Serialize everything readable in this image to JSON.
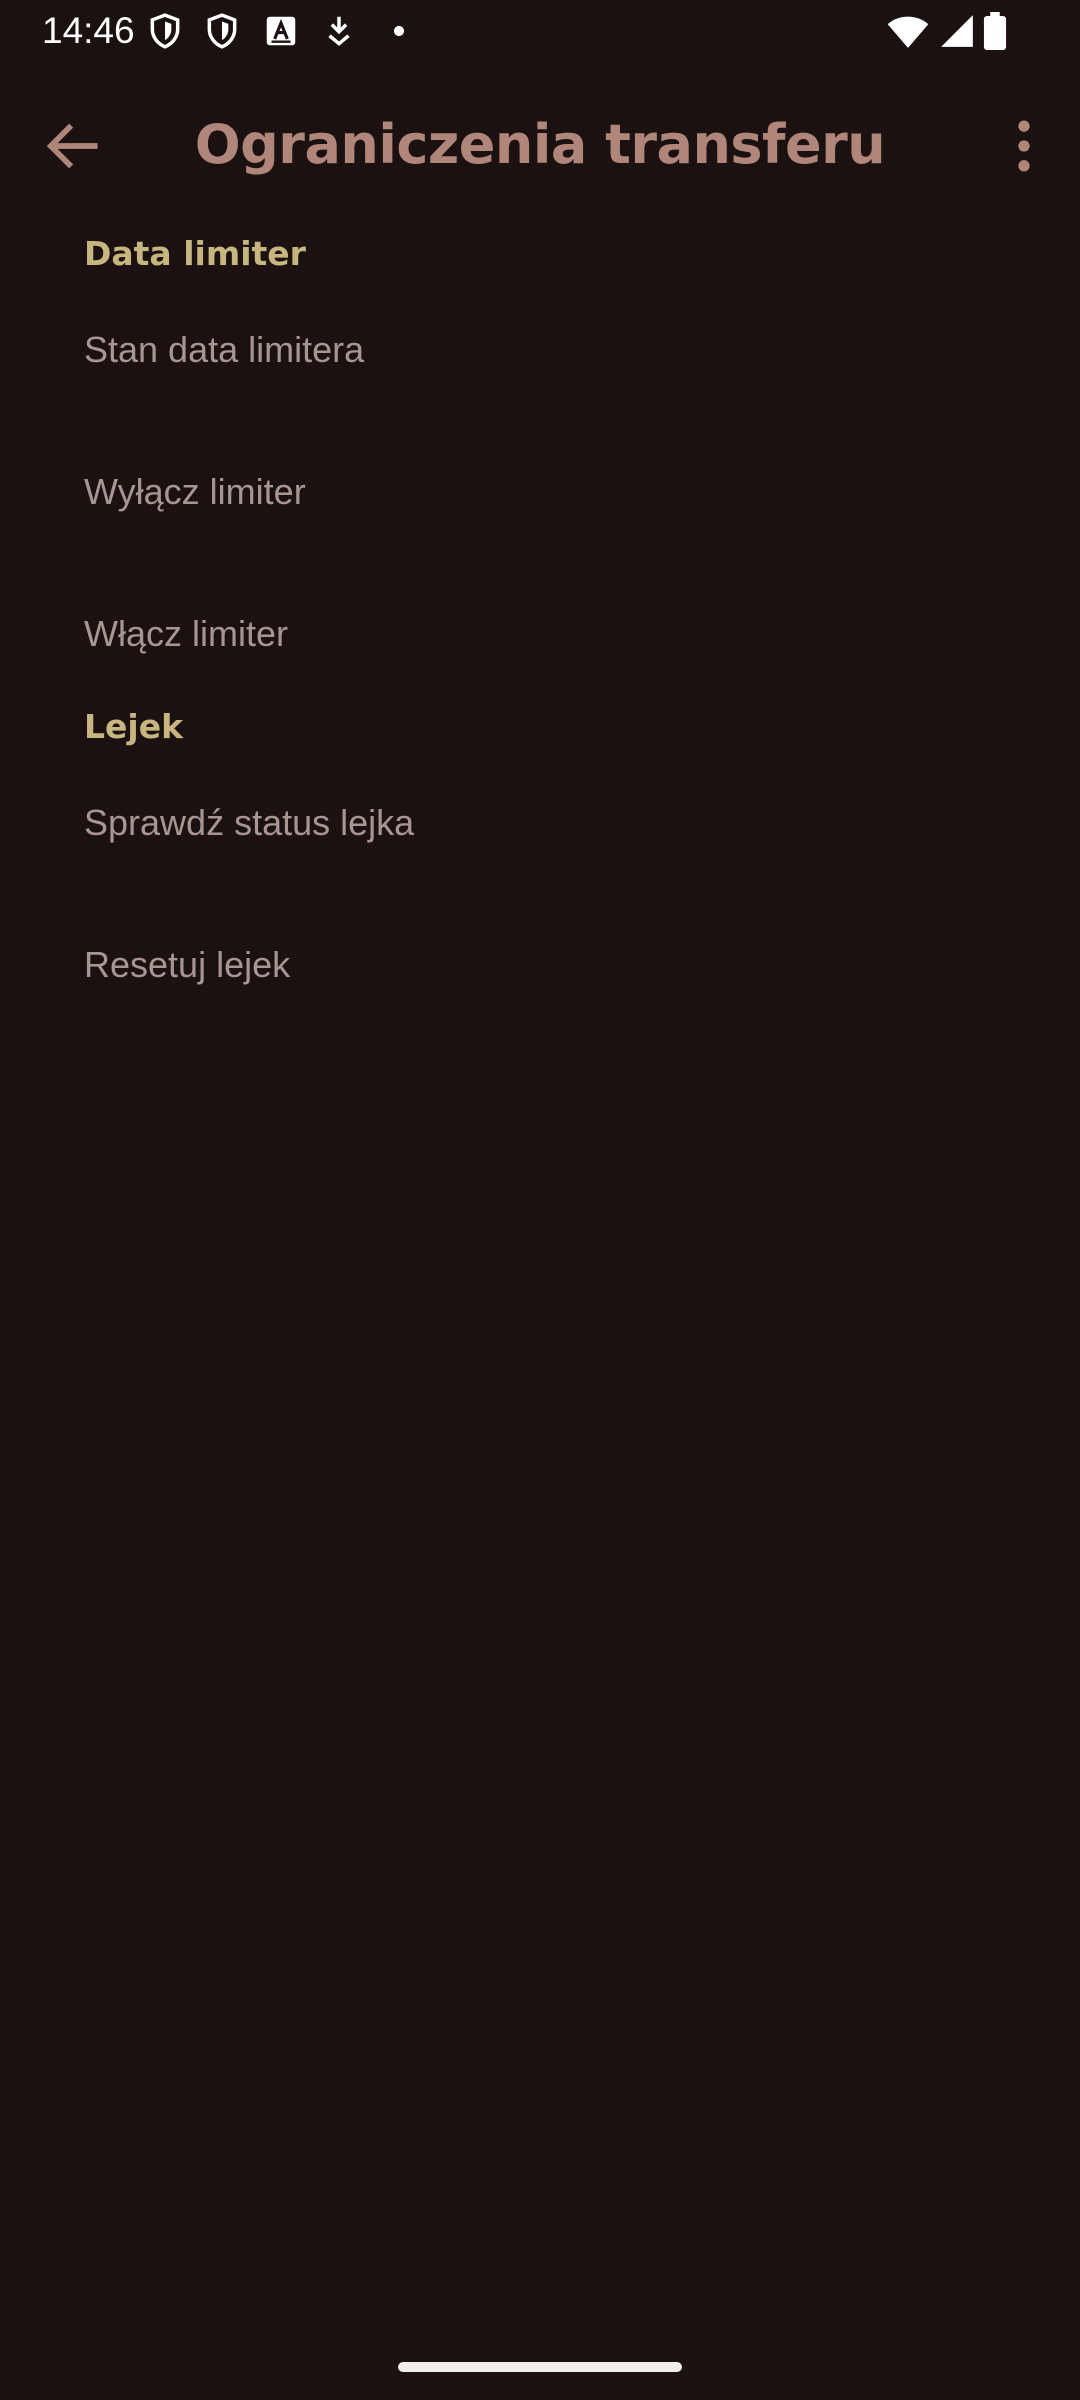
{
  "status_bar": {
    "time": "14:46",
    "left_icons": [
      "shield-icon",
      "shield-icon",
      "keyboard-a-icon",
      "download-arrow-icon",
      "dot-icon"
    ],
    "right_icons": [
      "wifi-icon",
      "cellular-signal-icon",
      "battery-icon"
    ]
  },
  "app_bar": {
    "back_icon": "arrow-back-icon",
    "title": "Ograniczenia transferu",
    "overflow_icon": "more-vert-icon"
  },
  "sections": [
    {
      "header": "Data limiter",
      "items": [
        {
          "label": "Stan data limitera"
        },
        {
          "label": "Wyłącz limiter"
        },
        {
          "label": "Włącz limiter"
        }
      ]
    },
    {
      "header": "Lejek",
      "items": [
        {
          "label": "Sprawdź status lejka"
        },
        {
          "label": "Resetuj lejek"
        }
      ]
    }
  ],
  "colors": {
    "background": "#1a1110",
    "title": "#b0867a",
    "section_header": "#c8b681",
    "item_text": "#a89692",
    "status_bar_text": "#ffffff"
  }
}
